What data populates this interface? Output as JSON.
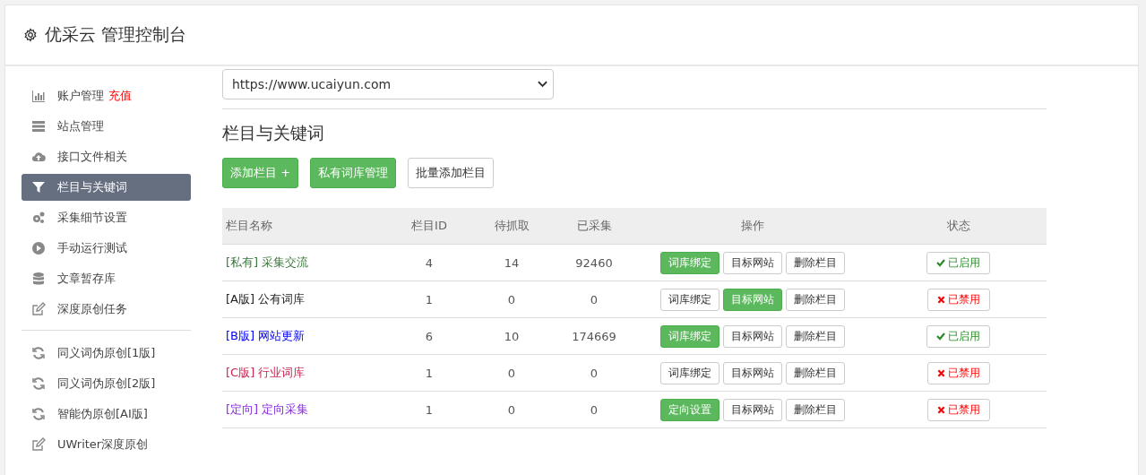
{
  "header": {
    "title": "优采云 管理控制台"
  },
  "sidebar": {
    "groups": [
      {
        "items": [
          {
            "label": "账户管理",
            "badge": "充值",
            "selected": false
          },
          {
            "label": "站点管理",
            "selected": false
          },
          {
            "label": "接口文件相关",
            "selected": false
          },
          {
            "label": "栏目与关键词",
            "selected": true
          },
          {
            "label": "采集细节设置",
            "selected": false
          },
          {
            "label": "手动运行测试",
            "selected": false
          },
          {
            "label": "文章暂存库",
            "selected": false
          },
          {
            "label": "深度原创任务",
            "selected": false
          }
        ]
      },
      {
        "items": [
          {
            "label": "同义词伪原创[1版]",
            "selected": false
          },
          {
            "label": "同义词伪原创[2版]",
            "selected": false
          },
          {
            "label": "智能伪原创[AI版]",
            "selected": false
          },
          {
            "label": "UWriter深度原创",
            "selected": false
          }
        ]
      }
    ]
  },
  "site_select": {
    "value": "https://www.ucaiyun.com"
  },
  "section": {
    "title": "栏目与关键词"
  },
  "toolbar": [
    {
      "label": "添加栏目 +",
      "kind": "primary"
    },
    {
      "label": "私有词库管理",
      "kind": "primary"
    },
    {
      "label": "批量添加栏目",
      "kind": "default"
    }
  ],
  "table": {
    "columns": [
      "栏目名称",
      "栏目ID",
      "待抓取",
      "已采集",
      "操作",
      "状态"
    ],
    "rows": [
      {
        "name": "[私有] 采集交流",
        "color": "#3c763d",
        "id": "4",
        "pending": "14",
        "collected": "92460",
        "actions": [
          {
            "label": "词库绑定",
            "on": true
          },
          {
            "label": "目标网站",
            "on": false
          },
          {
            "label": "删除栏目",
            "on": false
          }
        ],
        "enabled": true,
        "status": "已启用"
      },
      {
        "name": "[A版] 公有词库",
        "color": "#222222",
        "id": "1",
        "pending": "0",
        "collected": "0",
        "actions": [
          {
            "label": "词库绑定",
            "on": false
          },
          {
            "label": "目标网站",
            "on": true
          },
          {
            "label": "删除栏目",
            "on": false
          }
        ],
        "enabled": false,
        "status": "已禁用"
      },
      {
        "name": "[B版] 网站更新",
        "color": "#0000ff",
        "id": "6",
        "pending": "10",
        "collected": "174669",
        "actions": [
          {
            "label": "词库绑定",
            "on": true
          },
          {
            "label": "目标网站",
            "on": false
          },
          {
            "label": "删除栏目",
            "on": false
          }
        ],
        "enabled": true,
        "status": "已启用"
      },
      {
        "name": "[C版] 行业词库",
        "color": "#c7254e",
        "id": "1",
        "pending": "0",
        "collected": "0",
        "actions": [
          {
            "label": "词库绑定",
            "on": false
          },
          {
            "label": "目标网站",
            "on": false
          },
          {
            "label": "删除栏目",
            "on": false
          }
        ],
        "enabled": false,
        "status": "已禁用"
      },
      {
        "name": "[定向] 定向采集",
        "color": "#8a2be2",
        "id": "1",
        "pending": "0",
        "collected": "0",
        "actions": [
          {
            "label": "定向设置",
            "on": true
          },
          {
            "label": "目标网站",
            "on": false
          },
          {
            "label": "删除栏目",
            "on": false
          }
        ],
        "enabled": false,
        "status": "已禁用"
      }
    ]
  }
}
